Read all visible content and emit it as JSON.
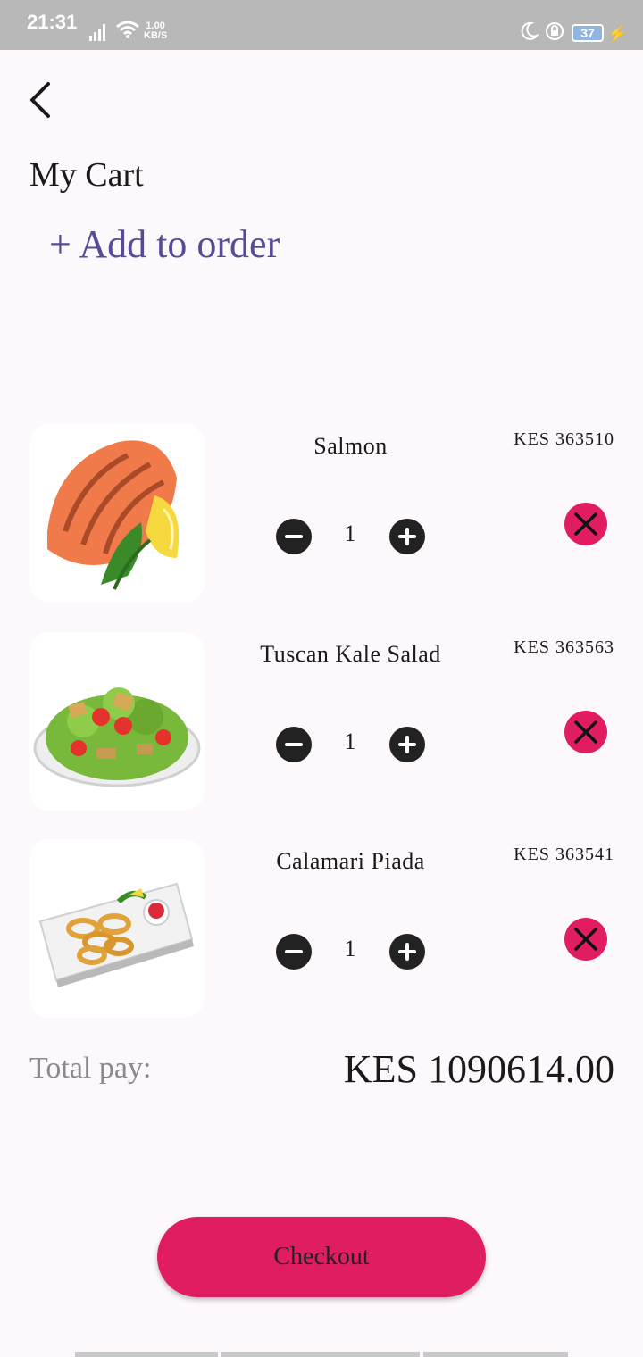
{
  "status_bar": {
    "time": "21:31",
    "speed_value": "1.00",
    "speed_unit": "KB/S",
    "battery": "37"
  },
  "header": {
    "back_icon": "chevron-left-icon",
    "title": "My Cart",
    "add_to_order": "+ Add to order"
  },
  "cart": {
    "items": [
      {
        "name": "Salmon",
        "price": "KES 363510",
        "quantity": "1"
      },
      {
        "name": "Tuscan Kale Salad",
        "price": "KES 363563",
        "quantity": "1"
      },
      {
        "name": "Calamari Piada",
        "price": "KES 363541",
        "quantity": "1"
      }
    ]
  },
  "total": {
    "label": "Total pay:",
    "value": "KES 1090614.00"
  },
  "checkout": {
    "label": "Checkout"
  },
  "colors": {
    "accent": "#e01d63",
    "link": "#5a4a96",
    "background": "#fdf8fb"
  }
}
